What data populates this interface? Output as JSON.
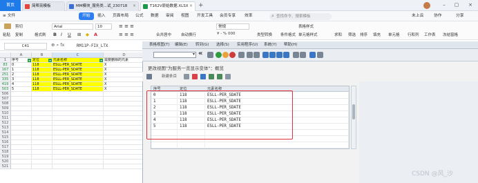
{
  "titlebar": {
    "home": "首页",
    "tabs": [
      {
        "label": "简帮亮模板",
        "color": "#e5463c"
      },
      {
        "label": "MM模块_服务类...试_230718",
        "color": "#3b6fd6"
      },
      {
        "label": "T162V原始数据.XLSX",
        "color": "#1a9b4a"
      }
    ]
  },
  "menu": {
    "items": [
      "≡ 文件",
      "开始",
      "插入",
      "页面布局",
      "公式",
      "数据",
      "审阅",
      "视图",
      "开发工具",
      "会员专享",
      "效率"
    ],
    "search_placeholder": "查找命令、搜索模板",
    "right": [
      "未上云",
      "协作",
      "分享"
    ]
  },
  "ribbon": {
    "paste": "粘贴",
    "cut": "剪切",
    "copy": "复制",
    "format_painter": "格式刷",
    "font_name": "Arial",
    "font_size": "10",
    "merge": "合并居中",
    "wrap": "自动换行",
    "number_format": "常规",
    "type_convert": "类型转换",
    "cond_format": "条件格式",
    "table_style": "表格样式",
    "cell_style": "单元格样式",
    "sum": "求和",
    "filter": "筛选",
    "sort": "排序",
    "fill": "填充",
    "cell": "单元格",
    "row_col": "行和列",
    "worksheet": "工作表",
    "freeze": "冻结窗格"
  },
  "formula": {
    "cell_ref": "C41",
    "value": "RM11P-FIX_LTX"
  },
  "sheet": {
    "columns": [
      "A",
      "B",
      "C",
      "D"
    ],
    "header": [
      "序号",
      "定位",
      "元素名称",
      "需要删除的元素"
    ],
    "rows": [
      {
        "row": "83",
        "a": "0",
        "b": "118",
        "c": "ESLL-PER_SDATE",
        "d": "X",
        "green": true
      },
      {
        "row": "167",
        "a": "1",
        "b": "118",
        "c": "ESLL-PER_SDATE",
        "d": "X",
        "green": true
      },
      {
        "row": "251",
        "a": "2",
        "b": "118",
        "c": "ESLL-PER_SDATE",
        "d": "X",
        "green": true
      },
      {
        "row": "335",
        "a": "3",
        "b": "118",
        "c": "ESLL-PER_SDATE",
        "d": "X",
        "green": true
      },
      {
        "row": "419",
        "a": "4",
        "b": "118",
        "c": "ESLL-PER_SDATE",
        "d": "X",
        "green": true
      },
      {
        "row": "503",
        "a": "5",
        "b": "118",
        "c": "ESLL-PER_SDATE",
        "d": "X",
        "green": true
      }
    ],
    "empty_rows": [
      "506",
      "507",
      "508",
      "509",
      "510",
      "511",
      "512",
      "513",
      "514",
      "515",
      "516",
      "517",
      "518",
      "519",
      "520",
      "521"
    ]
  },
  "sap": {
    "menu": [
      "表格视图(T)",
      "编辑(E)",
      "转到(G)",
      "选择(S)",
      "实用程序(U)",
      "系统(Y)",
      "帮助(H)"
    ],
    "title": "更改视图\"为服务一览显示变体\"：概览",
    "new_entry": "新建条目",
    "columns": [
      "序号",
      "定位",
      "元素名称"
    ],
    "rows": [
      {
        "seq": "0",
        "pos": "118",
        "name": "ESLL-PER_SDATE"
      },
      {
        "seq": "1",
        "pos": "118",
        "name": "ESLL-PER_SDATE"
      },
      {
        "seq": "2",
        "pos": "118",
        "name": "ESLL-PER_SDATE"
      },
      {
        "seq": "3",
        "pos": "118",
        "name": "ESLL-PER_SDATE"
      },
      {
        "seq": "4",
        "pos": "118",
        "name": "ESLL-PER_SDATE"
      },
      {
        "seq": "5",
        "pos": "118",
        "name": "ESLL-PER_SDATE"
      }
    ],
    "highlight_color": "#e0303a"
  },
  "watermark": "CSDN @风_沙"
}
